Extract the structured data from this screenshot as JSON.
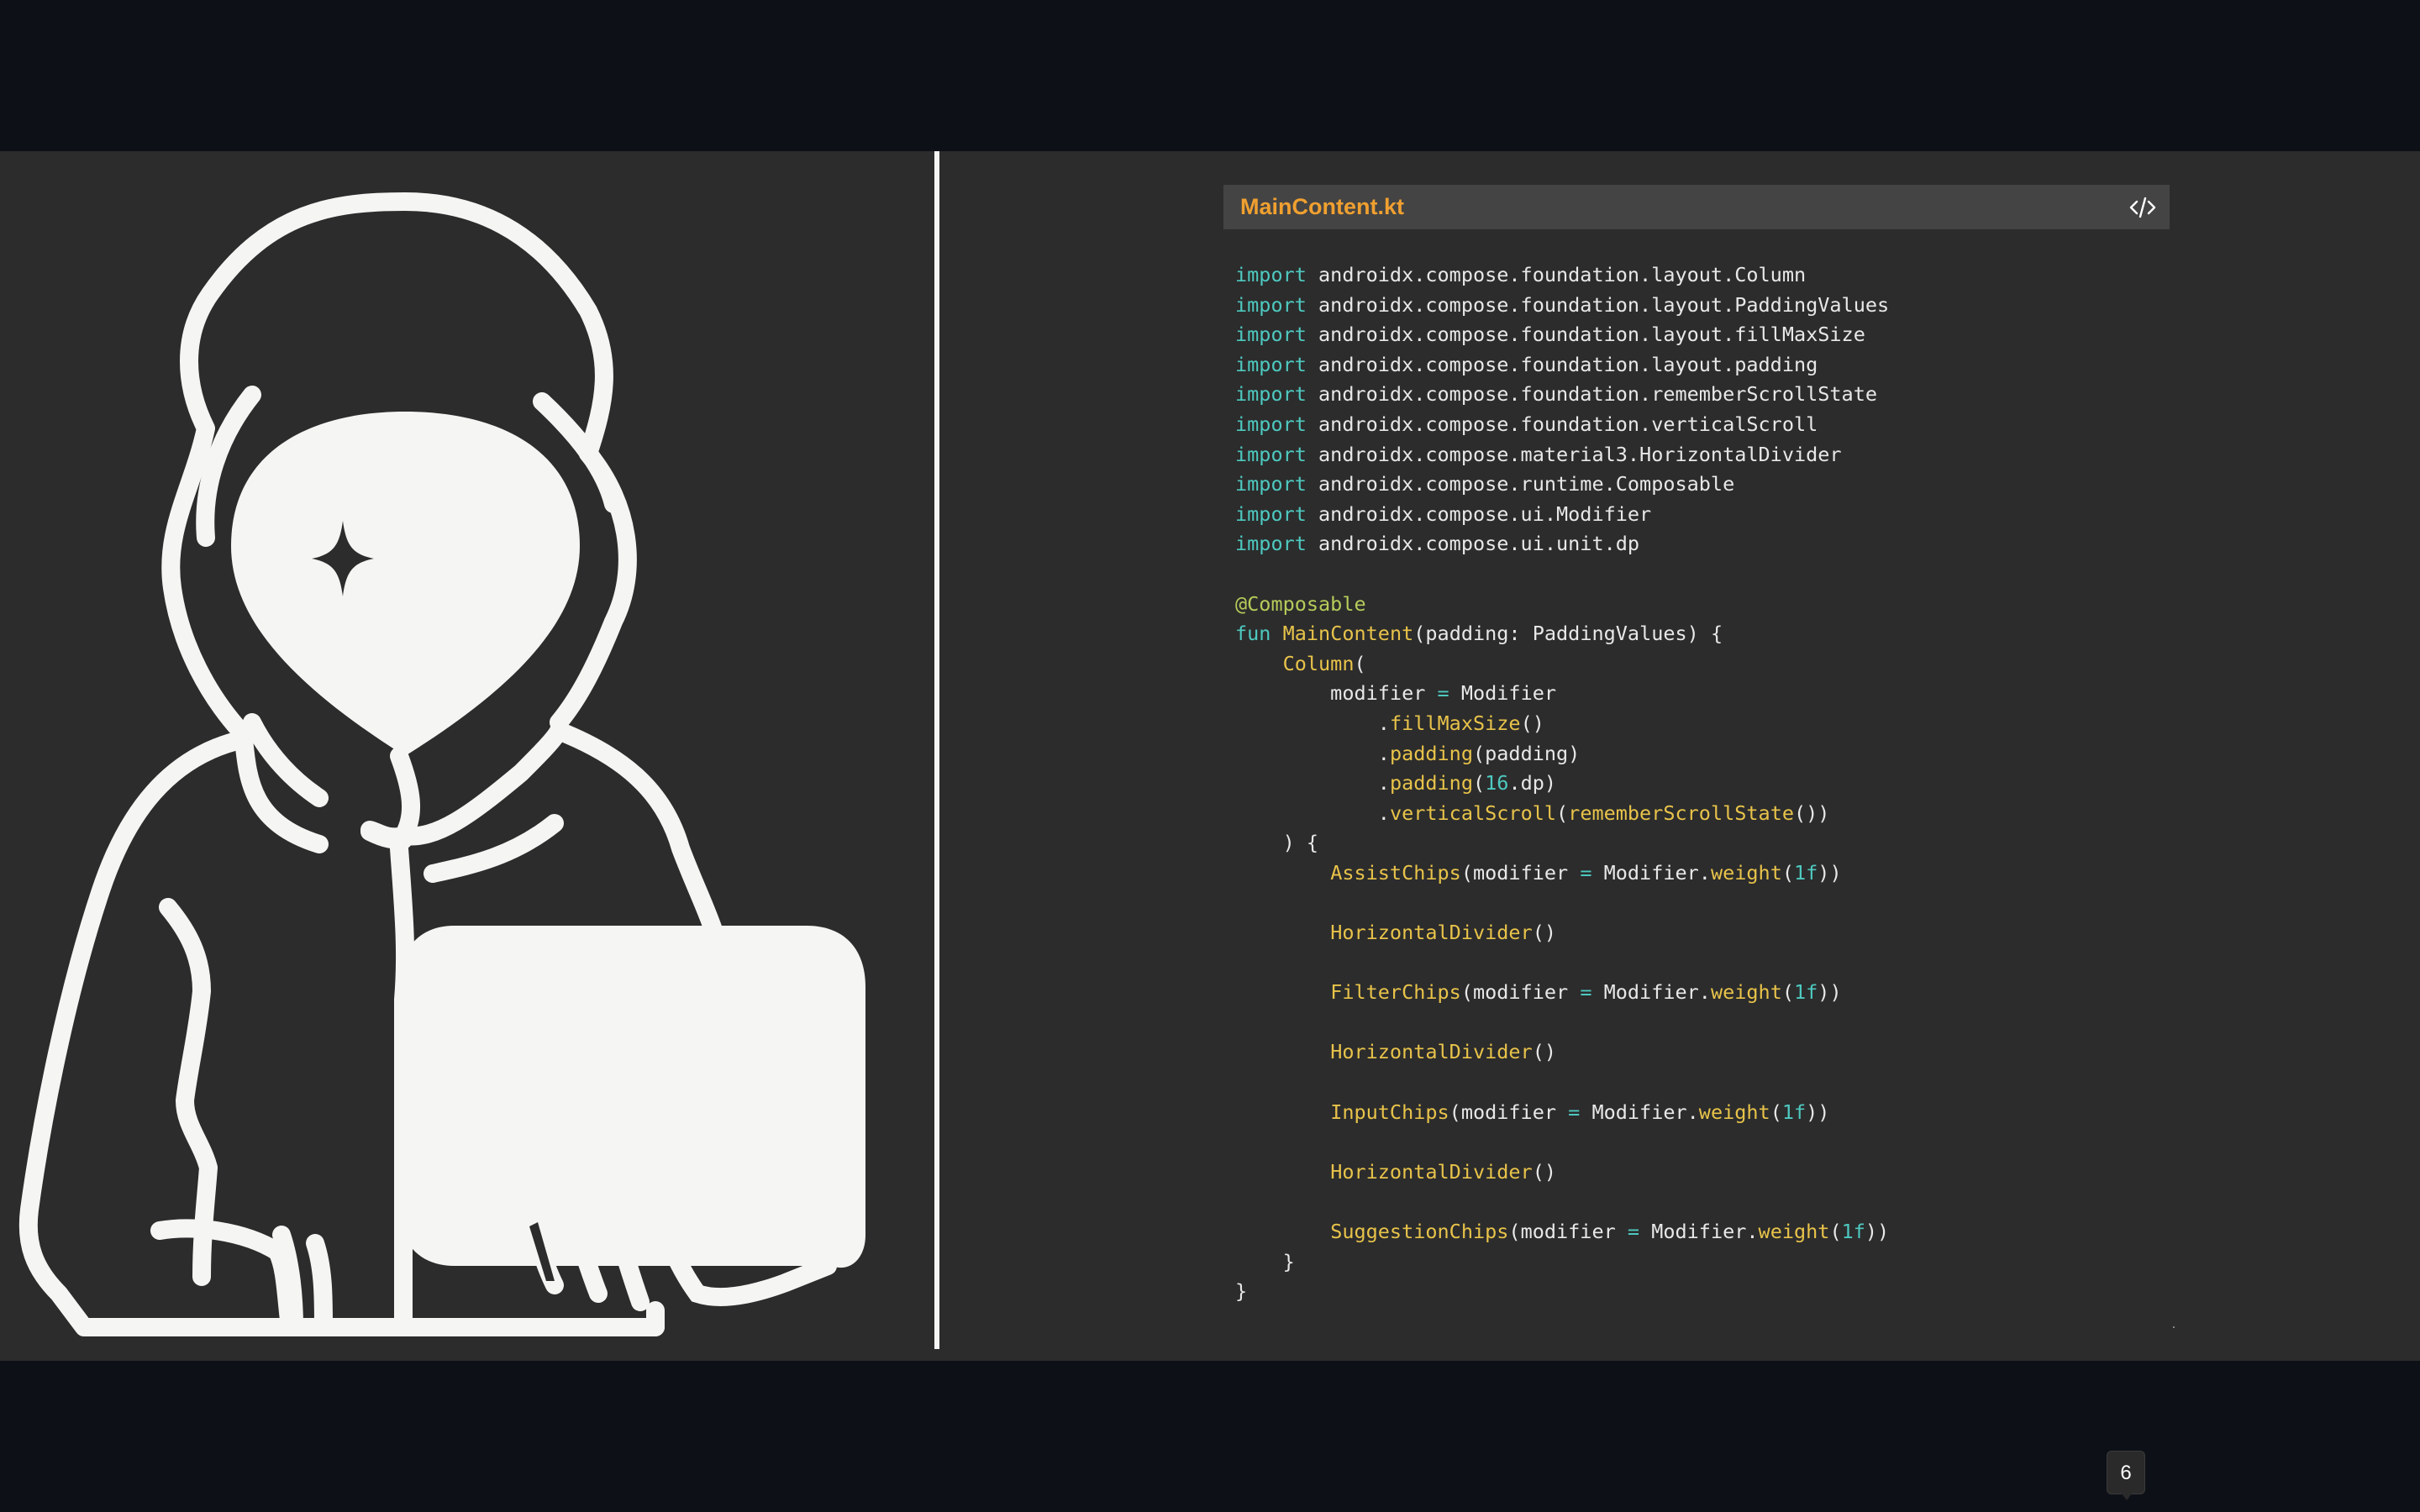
{
  "file_card": {
    "file_name": "MainContent.kt",
    "icon": "code-brackets-icon"
  },
  "code": {
    "lines": [
      [
        {
          "t": "import",
          "c": "kw"
        },
        {
          "t": " androidx.compose.foundation.layout.Column"
        }
      ],
      [
        {
          "t": "import",
          "c": "kw"
        },
        {
          "t": " androidx.compose.foundation.layout.PaddingValues"
        }
      ],
      [
        {
          "t": "import",
          "c": "kw"
        },
        {
          "t": " androidx.compose.foundation.layout.fillMaxSize"
        }
      ],
      [
        {
          "t": "import",
          "c": "kw"
        },
        {
          "t": " androidx.compose.foundation.layout.padding"
        }
      ],
      [
        {
          "t": "import",
          "c": "kw"
        },
        {
          "t": " androidx.compose.foundation.rememberScrollState"
        }
      ],
      [
        {
          "t": "import",
          "c": "kw"
        },
        {
          "t": " androidx.compose.foundation.verticalScroll"
        }
      ],
      [
        {
          "t": "import",
          "c": "kw"
        },
        {
          "t": " androidx.compose.material3.HorizontalDivider"
        }
      ],
      [
        {
          "t": "import",
          "c": "kw"
        },
        {
          "t": " androidx.compose.runtime.Composable"
        }
      ],
      [
        {
          "t": "import",
          "c": "kw"
        },
        {
          "t": " androidx.compose.ui.Modifier"
        }
      ],
      [
        {
          "t": "import",
          "c": "kw"
        },
        {
          "t": " androidx.compose.ui.unit.dp"
        }
      ],
      [],
      [
        {
          "t": "@Composable",
          "c": "anno"
        }
      ],
      [
        {
          "t": "fun",
          "c": "kw"
        },
        {
          "t": " "
        },
        {
          "t": "MainContent",
          "c": "fn"
        },
        {
          "t": "(padding: PaddingValues) {"
        }
      ],
      [
        {
          "t": "    "
        },
        {
          "t": "Column",
          "c": "fn"
        },
        {
          "t": "("
        }
      ],
      [
        {
          "t": "        modifier "
        },
        {
          "t": "=",
          "c": "op"
        },
        {
          "t": " Modifier"
        }
      ],
      [
        {
          "t": "            ."
        },
        {
          "t": "fillMaxSize",
          "c": "fn"
        },
        {
          "t": "()"
        }
      ],
      [
        {
          "t": "            ."
        },
        {
          "t": "padding",
          "c": "fn"
        },
        {
          "t": "(padding)"
        }
      ],
      [
        {
          "t": "            ."
        },
        {
          "t": "padding",
          "c": "fn"
        },
        {
          "t": "("
        },
        {
          "t": "16",
          "c": "num"
        },
        {
          "t": ".dp)"
        }
      ],
      [
        {
          "t": "            ."
        },
        {
          "t": "verticalScroll",
          "c": "fn"
        },
        {
          "t": "("
        },
        {
          "t": "rememberScrollState",
          "c": "fn"
        },
        {
          "t": "())"
        }
      ],
      [
        {
          "t": "    ) {"
        }
      ],
      [
        {
          "t": "        "
        },
        {
          "t": "AssistChips",
          "c": "fn"
        },
        {
          "t": "(modifier "
        },
        {
          "t": "=",
          "c": "op"
        },
        {
          "t": " Modifier."
        },
        {
          "t": "weight",
          "c": "fn"
        },
        {
          "t": "("
        },
        {
          "t": "1f",
          "c": "num"
        },
        {
          "t": "))"
        }
      ],
      [],
      [
        {
          "t": "        "
        },
        {
          "t": "HorizontalDivider",
          "c": "fn"
        },
        {
          "t": "()"
        }
      ],
      [],
      [
        {
          "t": "        "
        },
        {
          "t": "FilterChips",
          "c": "fn"
        },
        {
          "t": "(modifier "
        },
        {
          "t": "=",
          "c": "op"
        },
        {
          "t": " Modifier."
        },
        {
          "t": "weight",
          "c": "fn"
        },
        {
          "t": "("
        },
        {
          "t": "1f",
          "c": "num"
        },
        {
          "t": "))"
        }
      ],
      [],
      [
        {
          "t": "        "
        },
        {
          "t": "HorizontalDivider",
          "c": "fn"
        },
        {
          "t": "()"
        }
      ],
      [],
      [
        {
          "t": "        "
        },
        {
          "t": "InputChips",
          "c": "fn"
        },
        {
          "t": "(modifier "
        },
        {
          "t": "=",
          "c": "op"
        },
        {
          "t": " Modifier."
        },
        {
          "t": "weight",
          "c": "fn"
        },
        {
          "t": "("
        },
        {
          "t": "1f",
          "c": "num"
        },
        {
          "t": "))"
        }
      ],
      [],
      [
        {
          "t": "        "
        },
        {
          "t": "HorizontalDivider",
          "c": "fn"
        },
        {
          "t": "()"
        }
      ],
      [],
      [
        {
          "t": "        "
        },
        {
          "t": "SuggestionChips",
          "c": "fn"
        },
        {
          "t": "(modifier "
        },
        {
          "t": "=",
          "c": "op"
        },
        {
          "t": " Modifier."
        },
        {
          "t": "weight",
          "c": "fn"
        },
        {
          "t": "("
        },
        {
          "t": "1f",
          "c": "num"
        },
        {
          "t": "))"
        }
      ],
      [
        {
          "t": "    }"
        }
      ],
      [
        {
          "t": "}"
        }
      ]
    ]
  },
  "pagination": {
    "current_page": "6"
  },
  "illustration": {
    "icon": "hooded-hacker-laptop-icon"
  },
  "colors": {
    "keyword": "#4ec9c0",
    "function": "#e8c34a",
    "annotation": "#b5cc5a",
    "file_name": "#f0a030",
    "stage_background": "#2c2c2c",
    "outer_background": "#0d1117"
  }
}
